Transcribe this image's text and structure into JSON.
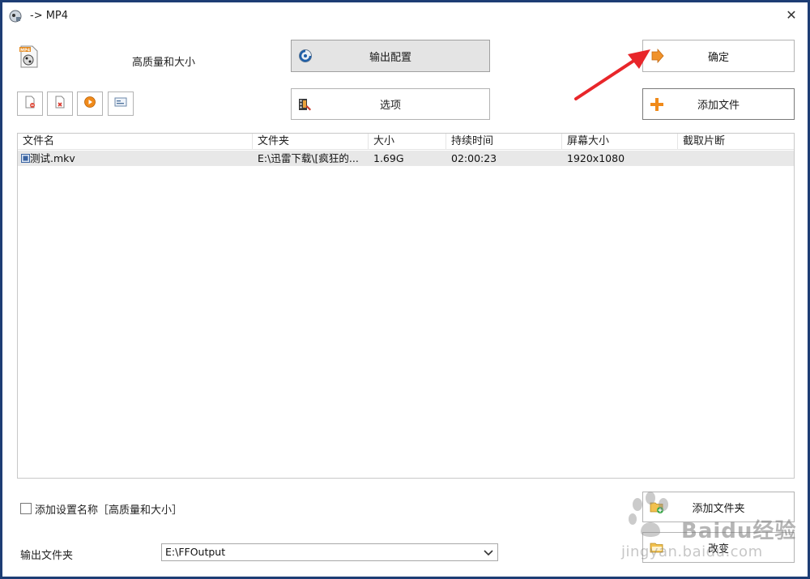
{
  "window": {
    "title": "-> MP4",
    "close_icon": "close-icon"
  },
  "profile": {
    "icon": "mp4-file-icon",
    "label": "高质量和大小"
  },
  "buttons": {
    "output_config": "输出配置",
    "ok": "确定",
    "options": "选项",
    "add_file": "添加文件",
    "add_folder": "添加文件夹",
    "change": "改变"
  },
  "small_toolbar": [
    {
      "name": "remove-file-button",
      "icon": "remove-icon"
    },
    {
      "name": "clear-list-button",
      "icon": "clear-icon"
    },
    {
      "name": "play-button",
      "icon": "play-icon"
    },
    {
      "name": "media-info-button",
      "icon": "info-icon"
    }
  ],
  "file_list": {
    "columns": [
      "文件名",
      "文件夹",
      "大小",
      "持续时间",
      "屏幕大小",
      "截取片断"
    ],
    "rows": [
      {
        "name": "测试.mkv",
        "folder": "E:\\迅雷下载\\[疯狂的...",
        "size": "1.69G",
        "duration": "02:00:23",
        "screen": "1920x1080",
        "clip": ""
      }
    ]
  },
  "checkbox": {
    "label": "添加设置名称［高质量和大小］",
    "checked": false
  },
  "output": {
    "label": "输出文件夹",
    "value": "E:\\FFOutput"
  },
  "watermark": {
    "main": "Baidu经验",
    "sub": "jingyan.baidu.com"
  },
  "colors": {
    "window_border": "#1d3d74",
    "selected_row": "#e8e8e8",
    "annotation_arrow": "#e8262a"
  }
}
